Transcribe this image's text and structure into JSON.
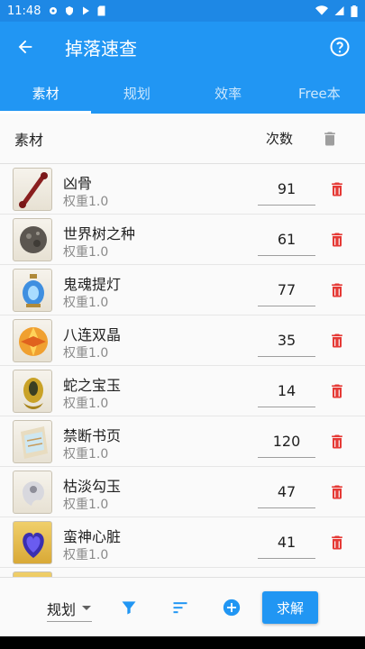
{
  "status": {
    "time": "11:48"
  },
  "appbar": {
    "title": "掉落速查"
  },
  "tabs": [
    {
      "label": "素材",
      "active": true
    },
    {
      "label": "规划",
      "active": false
    },
    {
      "label": "效率",
      "active": false
    },
    {
      "label": "Free本",
      "active": false
    }
  ],
  "list_header": {
    "item_label": "素材",
    "count_label": "次数"
  },
  "items": [
    {
      "name": "凶骨",
      "weight": "权重1.0",
      "count": "91",
      "icon": "bone-icon"
    },
    {
      "name": "世界树之种",
      "weight": "权重1.0",
      "count": "61",
      "icon": "seed-icon"
    },
    {
      "name": "鬼魂提灯",
      "weight": "权重1.0",
      "count": "77",
      "icon": "lantern-icon"
    },
    {
      "name": "八连双晶",
      "weight": "权重1.0",
      "count": "35",
      "icon": "crystal-icon"
    },
    {
      "name": "蛇之宝玉",
      "weight": "权重1.0",
      "count": "14",
      "icon": "jewel-icon"
    },
    {
      "name": "禁断书页",
      "weight": "权重1.0",
      "count": "120",
      "icon": "page-icon"
    },
    {
      "name": "枯淡勾玉",
      "weight": "权重1.0",
      "count": "47",
      "icon": "magatama-icon"
    },
    {
      "name": "蛮神心脏",
      "weight": "权重1.0",
      "count": "41",
      "icon": "heart-icon"
    }
  ],
  "bottom": {
    "mode_value": "规划",
    "solve_label": "求解"
  },
  "colors": {
    "primary": "#2196F3",
    "status": "#1E88E5",
    "delete": "#E53935"
  }
}
